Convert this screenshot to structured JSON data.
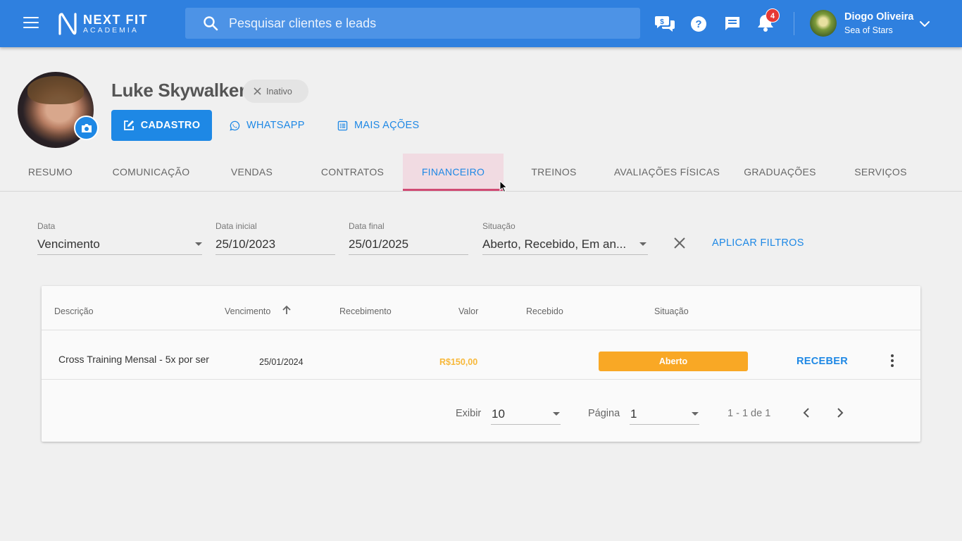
{
  "header": {
    "logo_name": "NEXT FIT",
    "logo_sub": "ACADEMIA",
    "search_placeholder": "Pesquisar clientes e leads",
    "notification_count": "4",
    "user_name": "Diogo Oliveira",
    "user_org": "Sea of Stars"
  },
  "profile": {
    "name": "Luke Skywalker",
    "status": "Inativo",
    "actions": {
      "cadastro": "CADASTRO",
      "whatsapp": "WHATSAPP",
      "mais_acoes": "MAIS AÇÕES"
    }
  },
  "tabs": [
    {
      "label": "RESUMO"
    },
    {
      "label": "COMUNICAÇÃO"
    },
    {
      "label": "VENDAS"
    },
    {
      "label": "CONTRATOS"
    },
    {
      "label": "FINANCEIRO"
    },
    {
      "label": "TREINOS"
    },
    {
      "label": "AVALIAÇÕES FÍSICAS"
    },
    {
      "label": "GRADUAÇÕES"
    },
    {
      "label": "SERVIÇOS"
    }
  ],
  "active_tab": "FINANCEIRO",
  "filters": {
    "data": {
      "label": "Data",
      "value": "Vencimento"
    },
    "data_inicial": {
      "label": "Data inicial",
      "value": "25/10/2023"
    },
    "data_final": {
      "label": "Data final",
      "value": "25/01/2025"
    },
    "situacao": {
      "label": "Situação",
      "value": "Aberto, Recebido, Em an..."
    },
    "apply_label": "APLICAR FILTROS"
  },
  "table": {
    "columns": [
      "Descrição",
      "Vencimento",
      "Recebimento",
      "Valor",
      "Recebido",
      "Situação"
    ],
    "rows": [
      {
        "descricao": "Cross Training Mensal - 5x por ser",
        "vencimento": "25/01/2024",
        "recebimento": "",
        "valor": "R$150,00",
        "recebido": "",
        "situacao": "Aberto",
        "action": "RECEBER"
      }
    ]
  },
  "pagination": {
    "exibir_label": "Exibir",
    "exibir_value": "10",
    "pagina_label": "Página",
    "pagina_value": "1",
    "range": "1 - 1 de 1"
  },
  "colors": {
    "primary": "#2f80df",
    "accent_blue": "#1e88e5",
    "status_aberto": "#f9a825",
    "tab_indicator": "#d14a73",
    "value_text": "#f7b83a"
  }
}
